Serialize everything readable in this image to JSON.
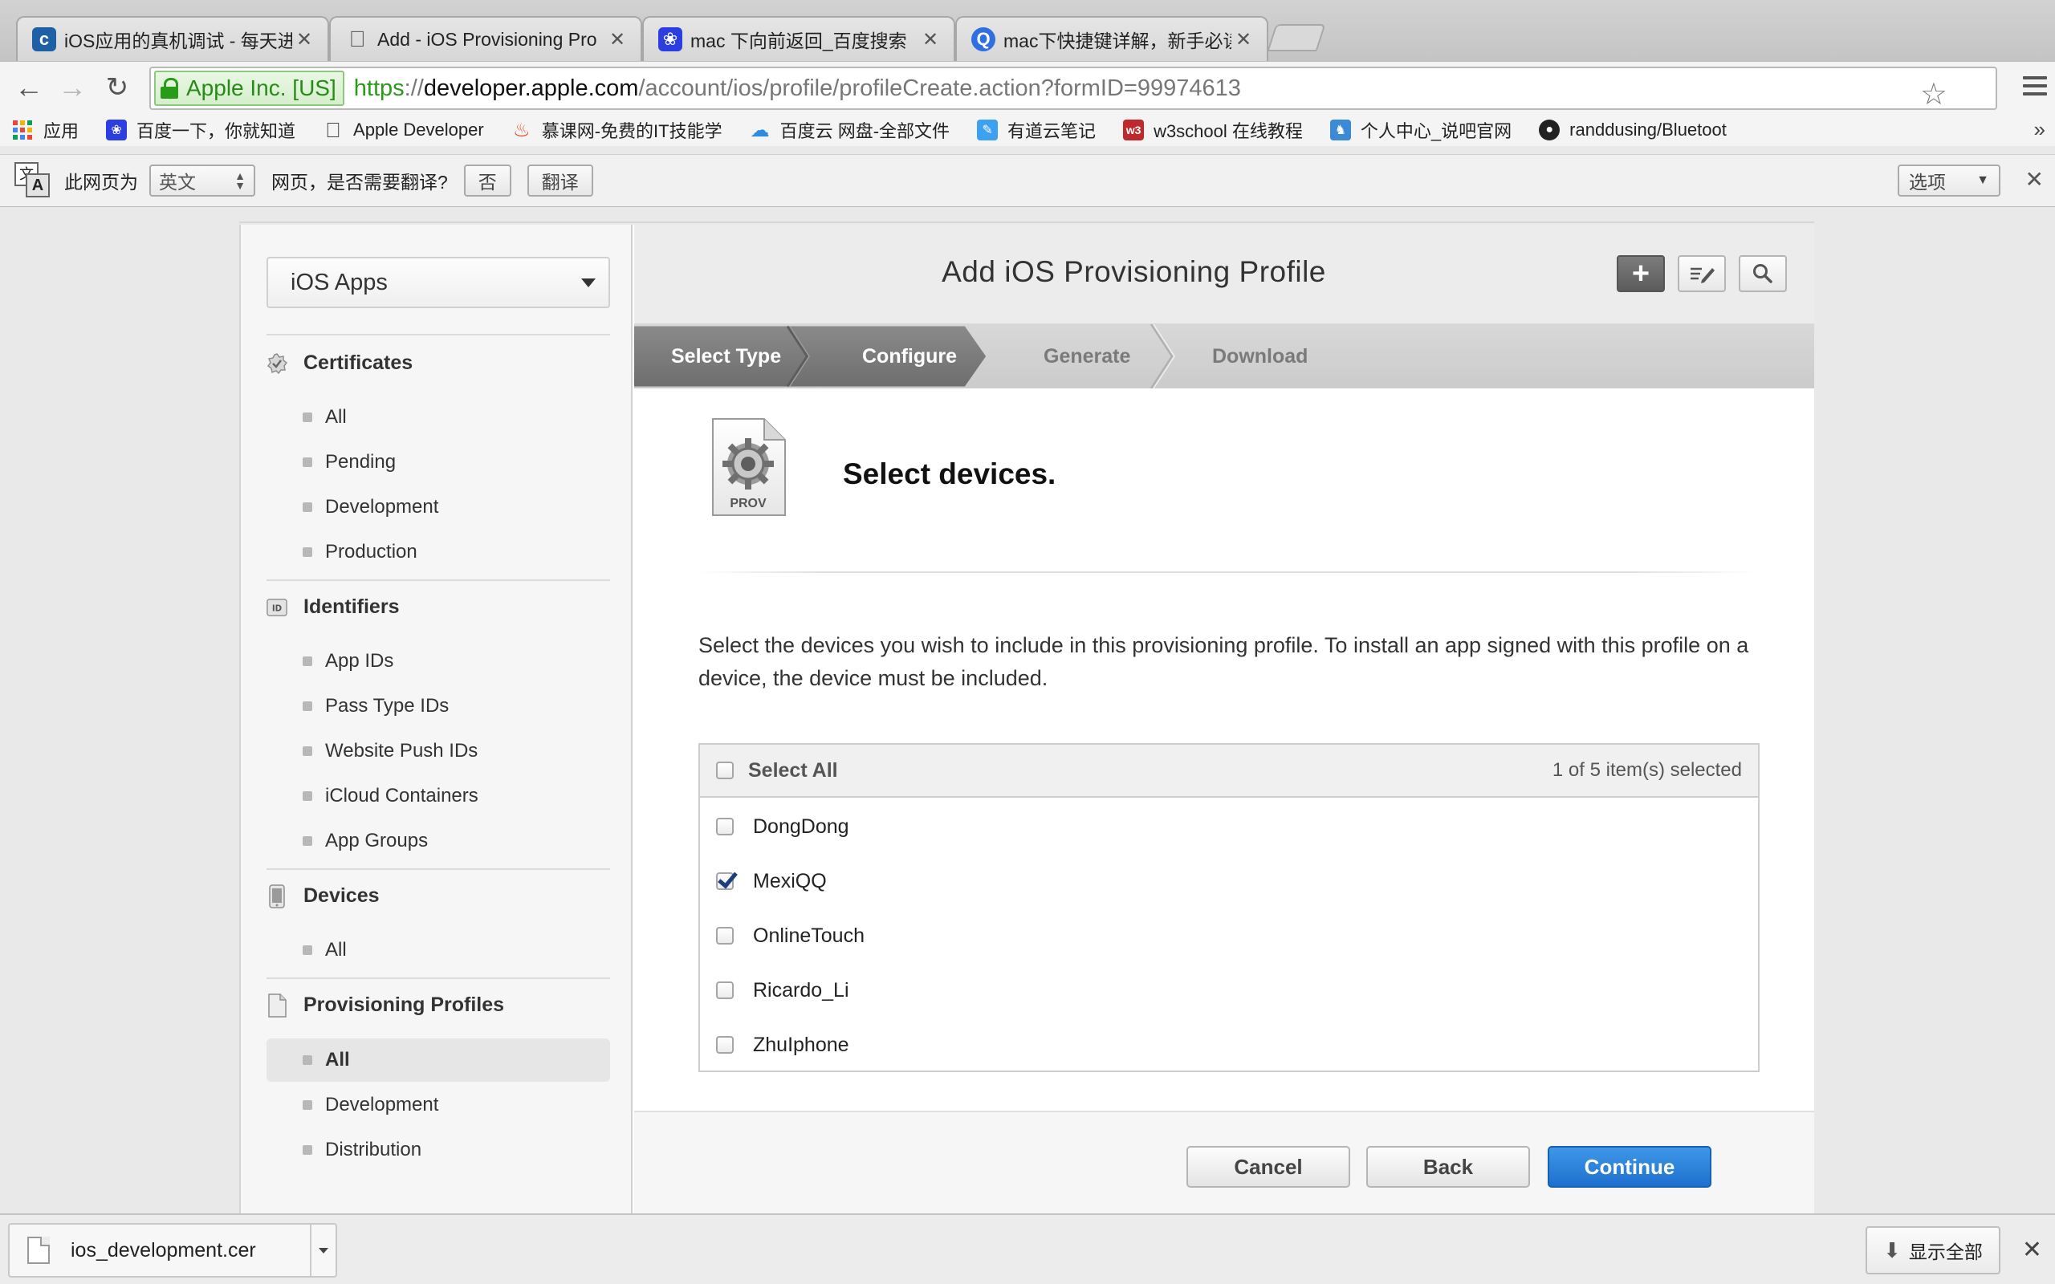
{
  "browser": {
    "tabs": [
      {
        "title": "iOS应用的真机调试 - 每天进",
        "favicon": "cnblogs-icon",
        "color": "#1f5fa5",
        "active": false
      },
      {
        "title": "Add - iOS Provisioning Pro",
        "favicon": "apple-icon",
        "color": "#555555",
        "active": true
      },
      {
        "title": "mac 下向前返回_百度搜索",
        "favicon": "baidu-paw-icon",
        "color": "#2b3ee0",
        "active": false
      },
      {
        "title": "mac下快捷键详解，新手必读",
        "favicon": "search-q-icon",
        "color": "#2f6fe0",
        "active": false
      }
    ],
    "url": {
      "ev_label": "Apple Inc. [US]",
      "scheme": "https",
      "sep": "://",
      "host": "developer.apple.com",
      "path": "/account/ios/profile/profileCreate.action?formID=99974613"
    },
    "bookmarks": [
      {
        "label": "应用",
        "icon": "apps-grid-icon",
        "color": "#e8453c"
      },
      {
        "label": "百度一下，你就知道",
        "icon": "baidu-paw-icon",
        "color": "#2b3ee0"
      },
      {
        "label": "Apple Developer",
        "icon": "apple-icon",
        "color": "#444444"
      },
      {
        "label": "慕课网-免费的IT技能学",
        "icon": "flame-icon",
        "color": "#e2451d"
      },
      {
        "label": "百度云 网盘-全部文件",
        "icon": "cloud-icon",
        "color": "#2e8be0"
      },
      {
        "label": "有道云笔记",
        "icon": "note-icon",
        "color": "#3ea0f0"
      },
      {
        "label": "w3school 在线教程",
        "icon": "w3-icon",
        "color": "#c0292b"
      },
      {
        "label": "个人中心_说吧官网",
        "icon": "game-icon",
        "color": "#3b8ad8"
      },
      {
        "label": "randdusing/Bluetoot",
        "icon": "github-icon",
        "color": "#222222"
      }
    ],
    "translate": {
      "prefix": "此网页为",
      "language": "英文",
      "question": "网页，是否需要翻译?",
      "no_label": "否",
      "translate_label": "翻译",
      "options_label": "选项"
    }
  },
  "sidebar": {
    "platform": "iOS Apps",
    "sections": [
      {
        "title": "Certificates",
        "icon": "certificate-icon",
        "items": [
          "All",
          "Pending",
          "Development",
          "Production"
        ]
      },
      {
        "title": "Identifiers",
        "icon": "id-badge-icon",
        "items": [
          "App IDs",
          "Pass Type IDs",
          "Website Push IDs",
          "iCloud Containers",
          "App Groups"
        ]
      },
      {
        "title": "Devices",
        "icon": "iphone-icon",
        "items": [
          "All"
        ]
      },
      {
        "title": "Provisioning Profiles",
        "icon": "document-icon",
        "items": [
          "All",
          "Development",
          "Distribution"
        ],
        "selected": "All"
      }
    ]
  },
  "main": {
    "title": "Add iOS Provisioning Profile",
    "steps": [
      "Select Type",
      "Configure",
      "Generate",
      "Download"
    ],
    "steps_completed": 2,
    "icon_label": "PROV",
    "heading": "Select devices.",
    "description": "Select the devices you wish to include in this provisioning profile. To install an app signed with this profile on a device, the device must be included.",
    "select_all_label": "Select All",
    "selection_count": "1 of 5 item(s) selected",
    "devices": [
      {
        "name": "DongDong",
        "checked": false
      },
      {
        "name": "MexiQQ",
        "checked": true
      },
      {
        "name": "OnlineTouch",
        "checked": false
      },
      {
        "name": "Ricardo_Li",
        "checked": false
      },
      {
        "name": "ZhuIphone",
        "checked": false
      }
    ],
    "buttons": {
      "cancel": "Cancel",
      "back": "Back",
      "continue": "Continue"
    }
  },
  "downloads": {
    "file": "ios_development.cer",
    "show_all": "显示全部"
  }
}
